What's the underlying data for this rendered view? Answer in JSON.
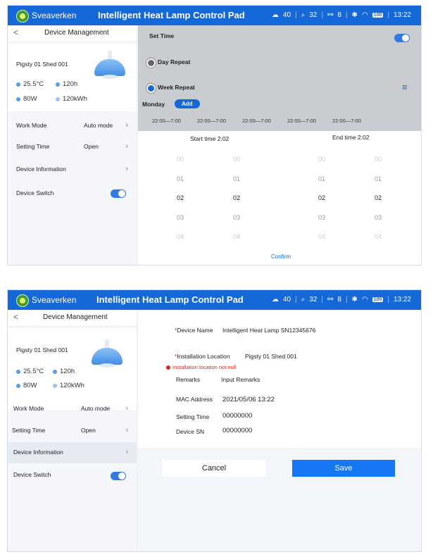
{
  "topbar": {
    "brand": "Sveaverken",
    "title": "Intelligent Heat Lamp Control Pad",
    "stat1_value": "40",
    "stat2_value": "32",
    "stat3_value": "8",
    "battery_label": "100",
    "time": "13:22"
  },
  "sidebar": {
    "back_label": "<",
    "title": "Device Management",
    "device_name": "Pigsty 01 Shed 001",
    "temperature": "25.5°C",
    "hours": "120h",
    "power": "80W",
    "energy": "120kWh",
    "menu": {
      "work_mode_label": "Work Mode",
      "work_mode_value": "Auto mode",
      "setting_time_label": "Setting Time",
      "setting_time_value": "Open",
      "device_info_label": "Device Information",
      "device_switch_label": "Device Switch"
    }
  },
  "set_time": {
    "title": "Set Time",
    "day_repeat_label": "Day Repeat",
    "week_repeat_label": "Week Repeat",
    "day_label": "Monday",
    "add_label": "Add",
    "segments": [
      "22:00—7:00",
      "22:00—7:00",
      "22:00—7:00",
      "22:00—7:00",
      "22:00—7:00"
    ],
    "start_label": "Start time 2:02",
    "end_label": "End time 2:02",
    "wheel_values": [
      "00",
      "01",
      "02",
      "03",
      "04"
    ],
    "confirm_label": "Confirm"
  },
  "device_form": {
    "device_name_label": "Device Name",
    "device_name_value": "Intelligent Heat Lamp SN12345676",
    "install_label": "Installation Location",
    "install_value": "Pigsty 01 Shed 001",
    "error_text": "Installation location not null",
    "remarks_label": "Remarks",
    "remarks_placeholder": "Input Remarks",
    "mac_label": "MAC Address",
    "mac_value": "2021/05/06 13:22",
    "setting_time_label": "Setting Time",
    "setting_time_value": "00000000",
    "device_sn_label": "Device SN",
    "device_sn_value": "00000000",
    "required_mark": "*",
    "cancel_label": "Cancel",
    "save_label": "Save"
  },
  "colors": {
    "primary": "#1668d8",
    "error": "#e02020",
    "overlay_gray": "#c9ccd1"
  },
  "icons": [
    "logo-icon",
    "cloud-icon",
    "tag-icon",
    "link-icon",
    "bluetooth-icon",
    "wifi-icon",
    "battery-icon",
    "lamp-icon",
    "chevron-right-icon",
    "list-icon"
  ]
}
